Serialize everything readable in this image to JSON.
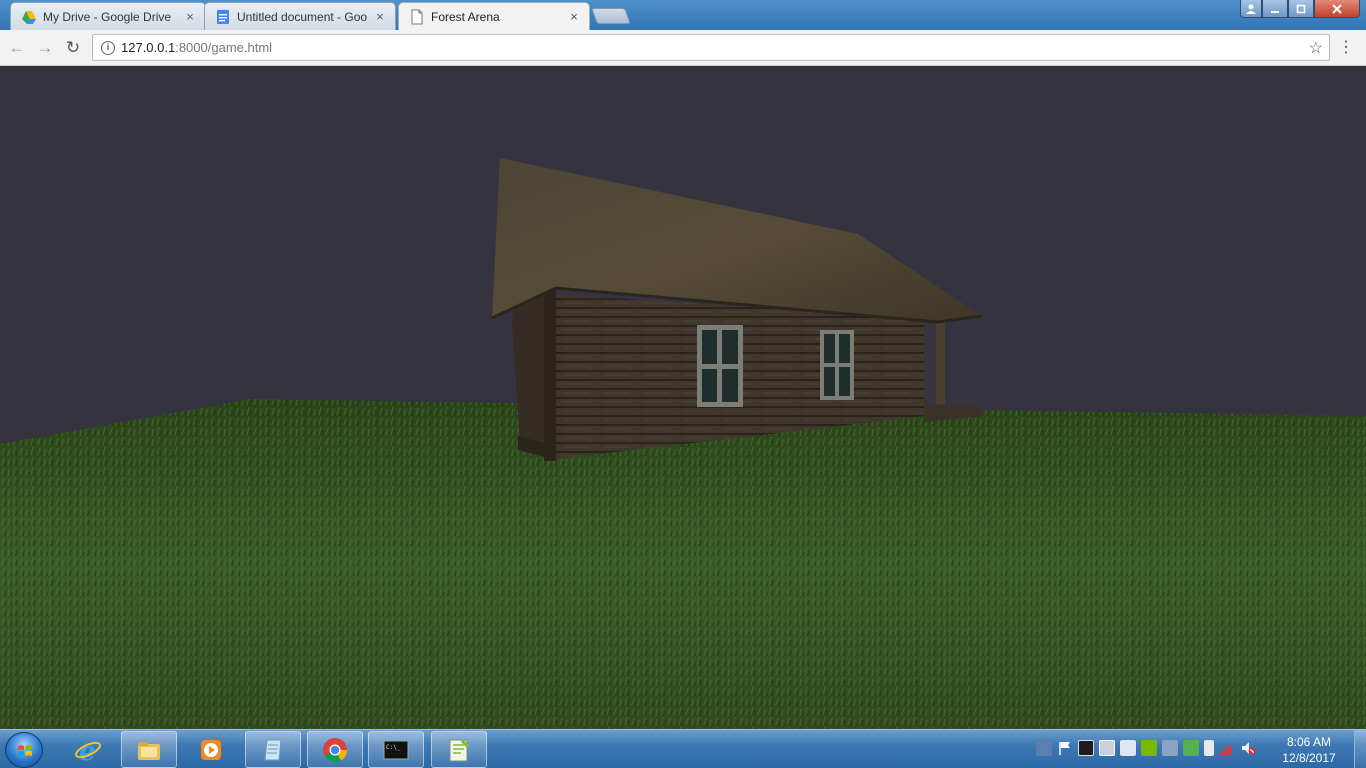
{
  "browser": {
    "tabs": [
      {
        "title": "My Drive - Google Drive",
        "icon": "google-drive-icon",
        "active": false
      },
      {
        "title": "Untitled document - Goo",
        "icon": "google-docs-icon",
        "active": false
      },
      {
        "title": "Forest Arena",
        "icon": "page-icon",
        "active": true
      }
    ],
    "close_glyph": "×",
    "url_host": "127.0.0.1",
    "url_path": ":8000/game.html"
  },
  "taskbar": {
    "pinned_apps": [
      "internet-explorer-icon",
      "file-explorer-icon",
      "media-player-icon",
      "notes-icon",
      "chrome-icon",
      "command-prompt-icon",
      "notepad-plus-icon"
    ],
    "tray_icons": [
      "network-icon",
      "action-center-flag-icon",
      "monitor-icon",
      "display-icon",
      "keyboard-icon",
      "nvidia-icon",
      "remote-icon",
      "security-icon",
      "battery-icon",
      "signal-icon",
      "volume-muted-icon"
    ],
    "time": "8:06 AM",
    "date": "12/8/2017"
  },
  "scene": {
    "sky_color": "#35333f",
    "ground_color": "#2e4a1f",
    "cabin_wall_color": "#3d342b",
    "roof_color": "#4a4233",
    "window_frame_color": "#7d7d78",
    "window_glass_color": "#1f2d2c"
  }
}
